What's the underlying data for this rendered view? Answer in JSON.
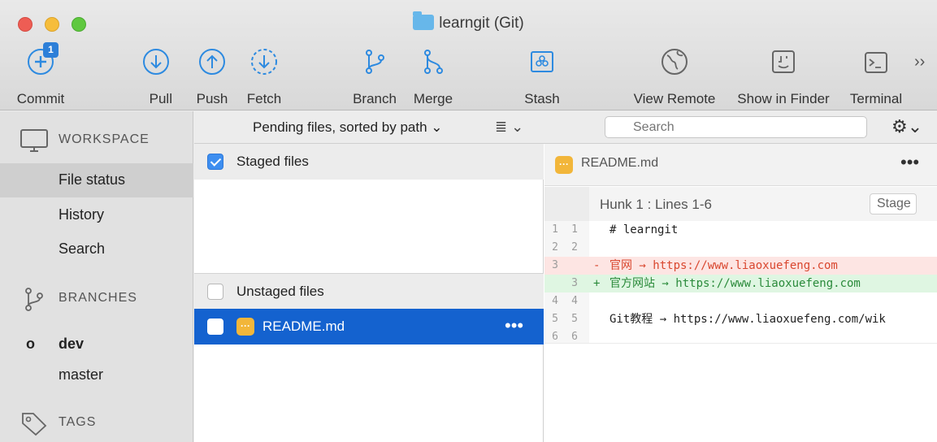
{
  "window": {
    "title": "learngit (Git)"
  },
  "toolbar": {
    "commit": {
      "label": "Commit",
      "badge": "1"
    },
    "pull": {
      "label": "Pull"
    },
    "push": {
      "label": "Push"
    },
    "fetch": {
      "label": "Fetch"
    },
    "branch": {
      "label": "Branch"
    },
    "merge": {
      "label": "Merge"
    },
    "stash": {
      "label": "Stash"
    },
    "view_remote": {
      "label": "View Remote"
    },
    "show_in_finder": {
      "label": "Show in Finder"
    },
    "terminal": {
      "label": "Terminal"
    },
    "overflow": "››"
  },
  "sidebar": {
    "workspace": {
      "label": "WORKSPACE",
      "items": [
        "File status",
        "History",
        "Search"
      ],
      "selected": "File status"
    },
    "branches": {
      "label": "BRANCHES",
      "items": [
        "dev",
        "master"
      ],
      "current": "dev"
    },
    "tags": {
      "label": "TAGS"
    }
  },
  "filterbar": {
    "sort": "Pending files, sorted by path ⌄",
    "view_mode": "≣ ⌄",
    "search_placeholder": "Search",
    "settings": "⚙⌄"
  },
  "staged": {
    "label": "Staged files",
    "checked": true
  },
  "unstaged": {
    "label": "Unstaged files",
    "checked": false,
    "files": [
      {
        "name": "README.md",
        "more": "•••"
      }
    ]
  },
  "diff": {
    "file": "README.md",
    "more": "•••",
    "hunk": {
      "label": "Hunk 1 : Lines 1-6",
      "stage_button": "Stage"
    },
    "lines": [
      {
        "old": "1",
        "new": "1",
        "type": "ctx",
        "prefix": "",
        "text": "# learngit"
      },
      {
        "old": "2",
        "new": "2",
        "type": "ctx",
        "prefix": "",
        "text": ""
      },
      {
        "old": "3",
        "new": "",
        "type": "del",
        "prefix": "-",
        "text": "官网 → https://www.liaoxuefeng.com"
      },
      {
        "old": "",
        "new": "3",
        "type": "add",
        "prefix": "+",
        "text": "官方网站 → https://www.liaoxuefeng.com"
      },
      {
        "old": "4",
        "new": "4",
        "type": "ctx",
        "prefix": "",
        "text": ""
      },
      {
        "old": "5",
        "new": "5",
        "type": "ctx",
        "prefix": "",
        "text": "Git教程 → https://www.liaoxuefeng.com/wik"
      },
      {
        "old": "6",
        "new": "6",
        "type": "ctx",
        "prefix": "",
        "text": ""
      }
    ]
  },
  "colors": {
    "accent": "#2d8ae0",
    "selection": "#1462cf",
    "deleted_bg": "#fde5e3",
    "added_bg": "#dff6e2"
  }
}
